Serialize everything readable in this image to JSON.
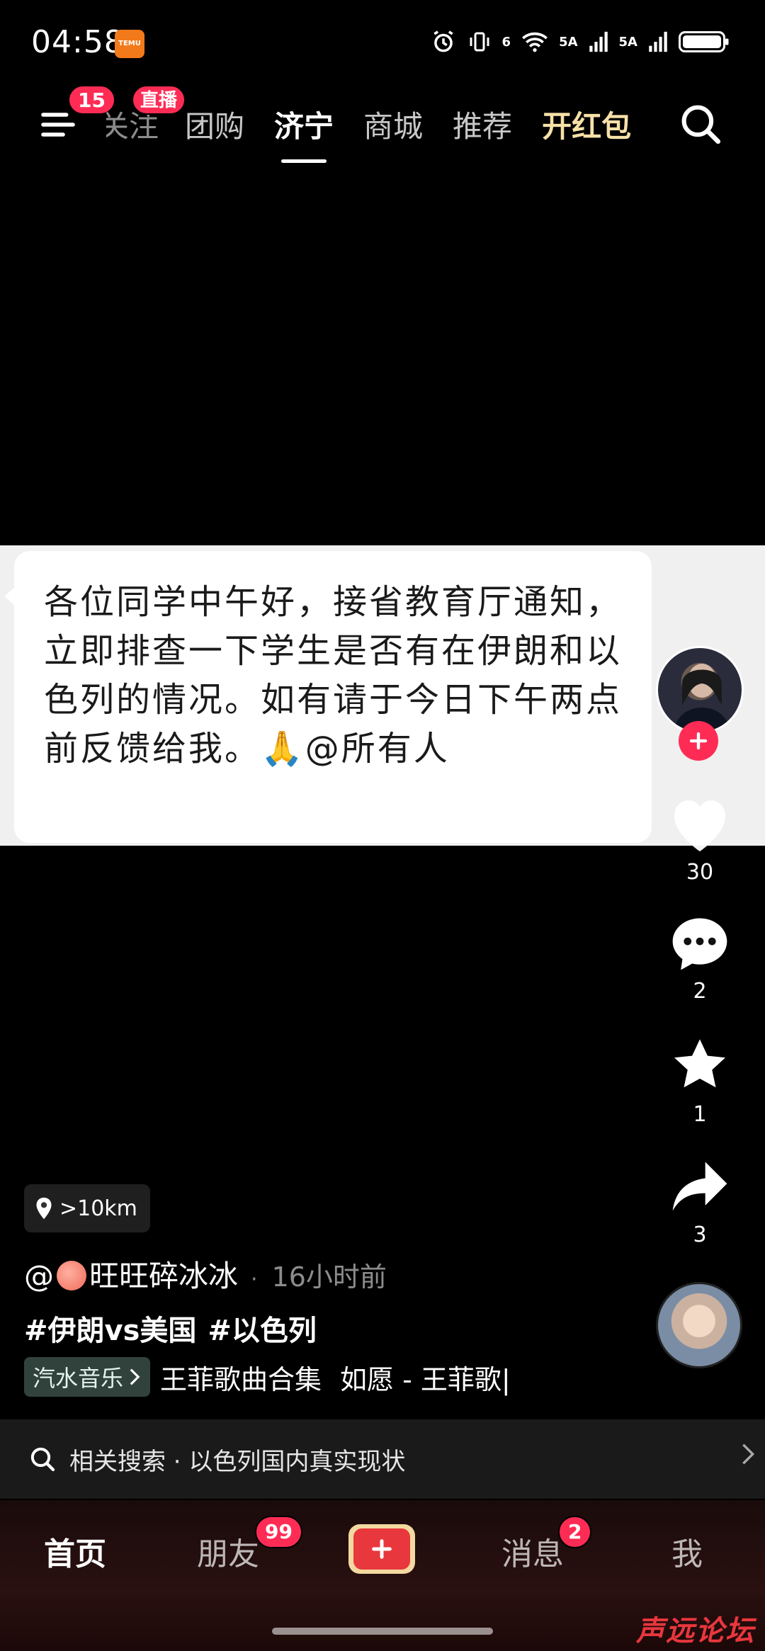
{
  "status_bar": {
    "time": "04:58",
    "temu_icon_text": "TEMU",
    "network_1": "5A",
    "network_2": "5A",
    "wifi_label": "6"
  },
  "top_nav": {
    "menu_badge": "15",
    "live_badge": "直播",
    "tabs": [
      {
        "label": "关注"
      },
      {
        "label": "团购"
      },
      {
        "label": "济宁"
      },
      {
        "label": "商城"
      },
      {
        "label": "推荐"
      },
      {
        "label": "开红包"
      }
    ],
    "active_tab": "济宁"
  },
  "video": {
    "chat_message": "各位同学中午好，接省教育厅通知，立即排查一下学生是否有在伊朗和以色列的情况。如有请于今日下午两点前反馈给我。🙏@所有人"
  },
  "actions": {
    "likes": "30",
    "comments": "2",
    "favorites": "1",
    "shares": "3"
  },
  "post": {
    "location": ">10km",
    "author_prefix": "@",
    "author_name": "旺旺碎冰冰",
    "time_ago": "16小时前",
    "hashtags": [
      "#伊朗vs美国",
      "#以色列"
    ],
    "music_chip": "汽水音乐",
    "music_title": "王菲歌曲合集",
    "music_title_2": "如愿 - 王菲歌|"
  },
  "related_search": {
    "label": "相关搜索 · 以色列国内真实现状"
  },
  "bottom_tabs": {
    "home": "首页",
    "friends": "朋友",
    "friends_badge": "99",
    "inbox": "消息",
    "inbox_badge": "2",
    "me": "我"
  },
  "watermark": "声远论坛",
  "colors": {
    "accent_red": "#fe2c55",
    "gold": "#f3d9a0",
    "background": "#000000"
  }
}
